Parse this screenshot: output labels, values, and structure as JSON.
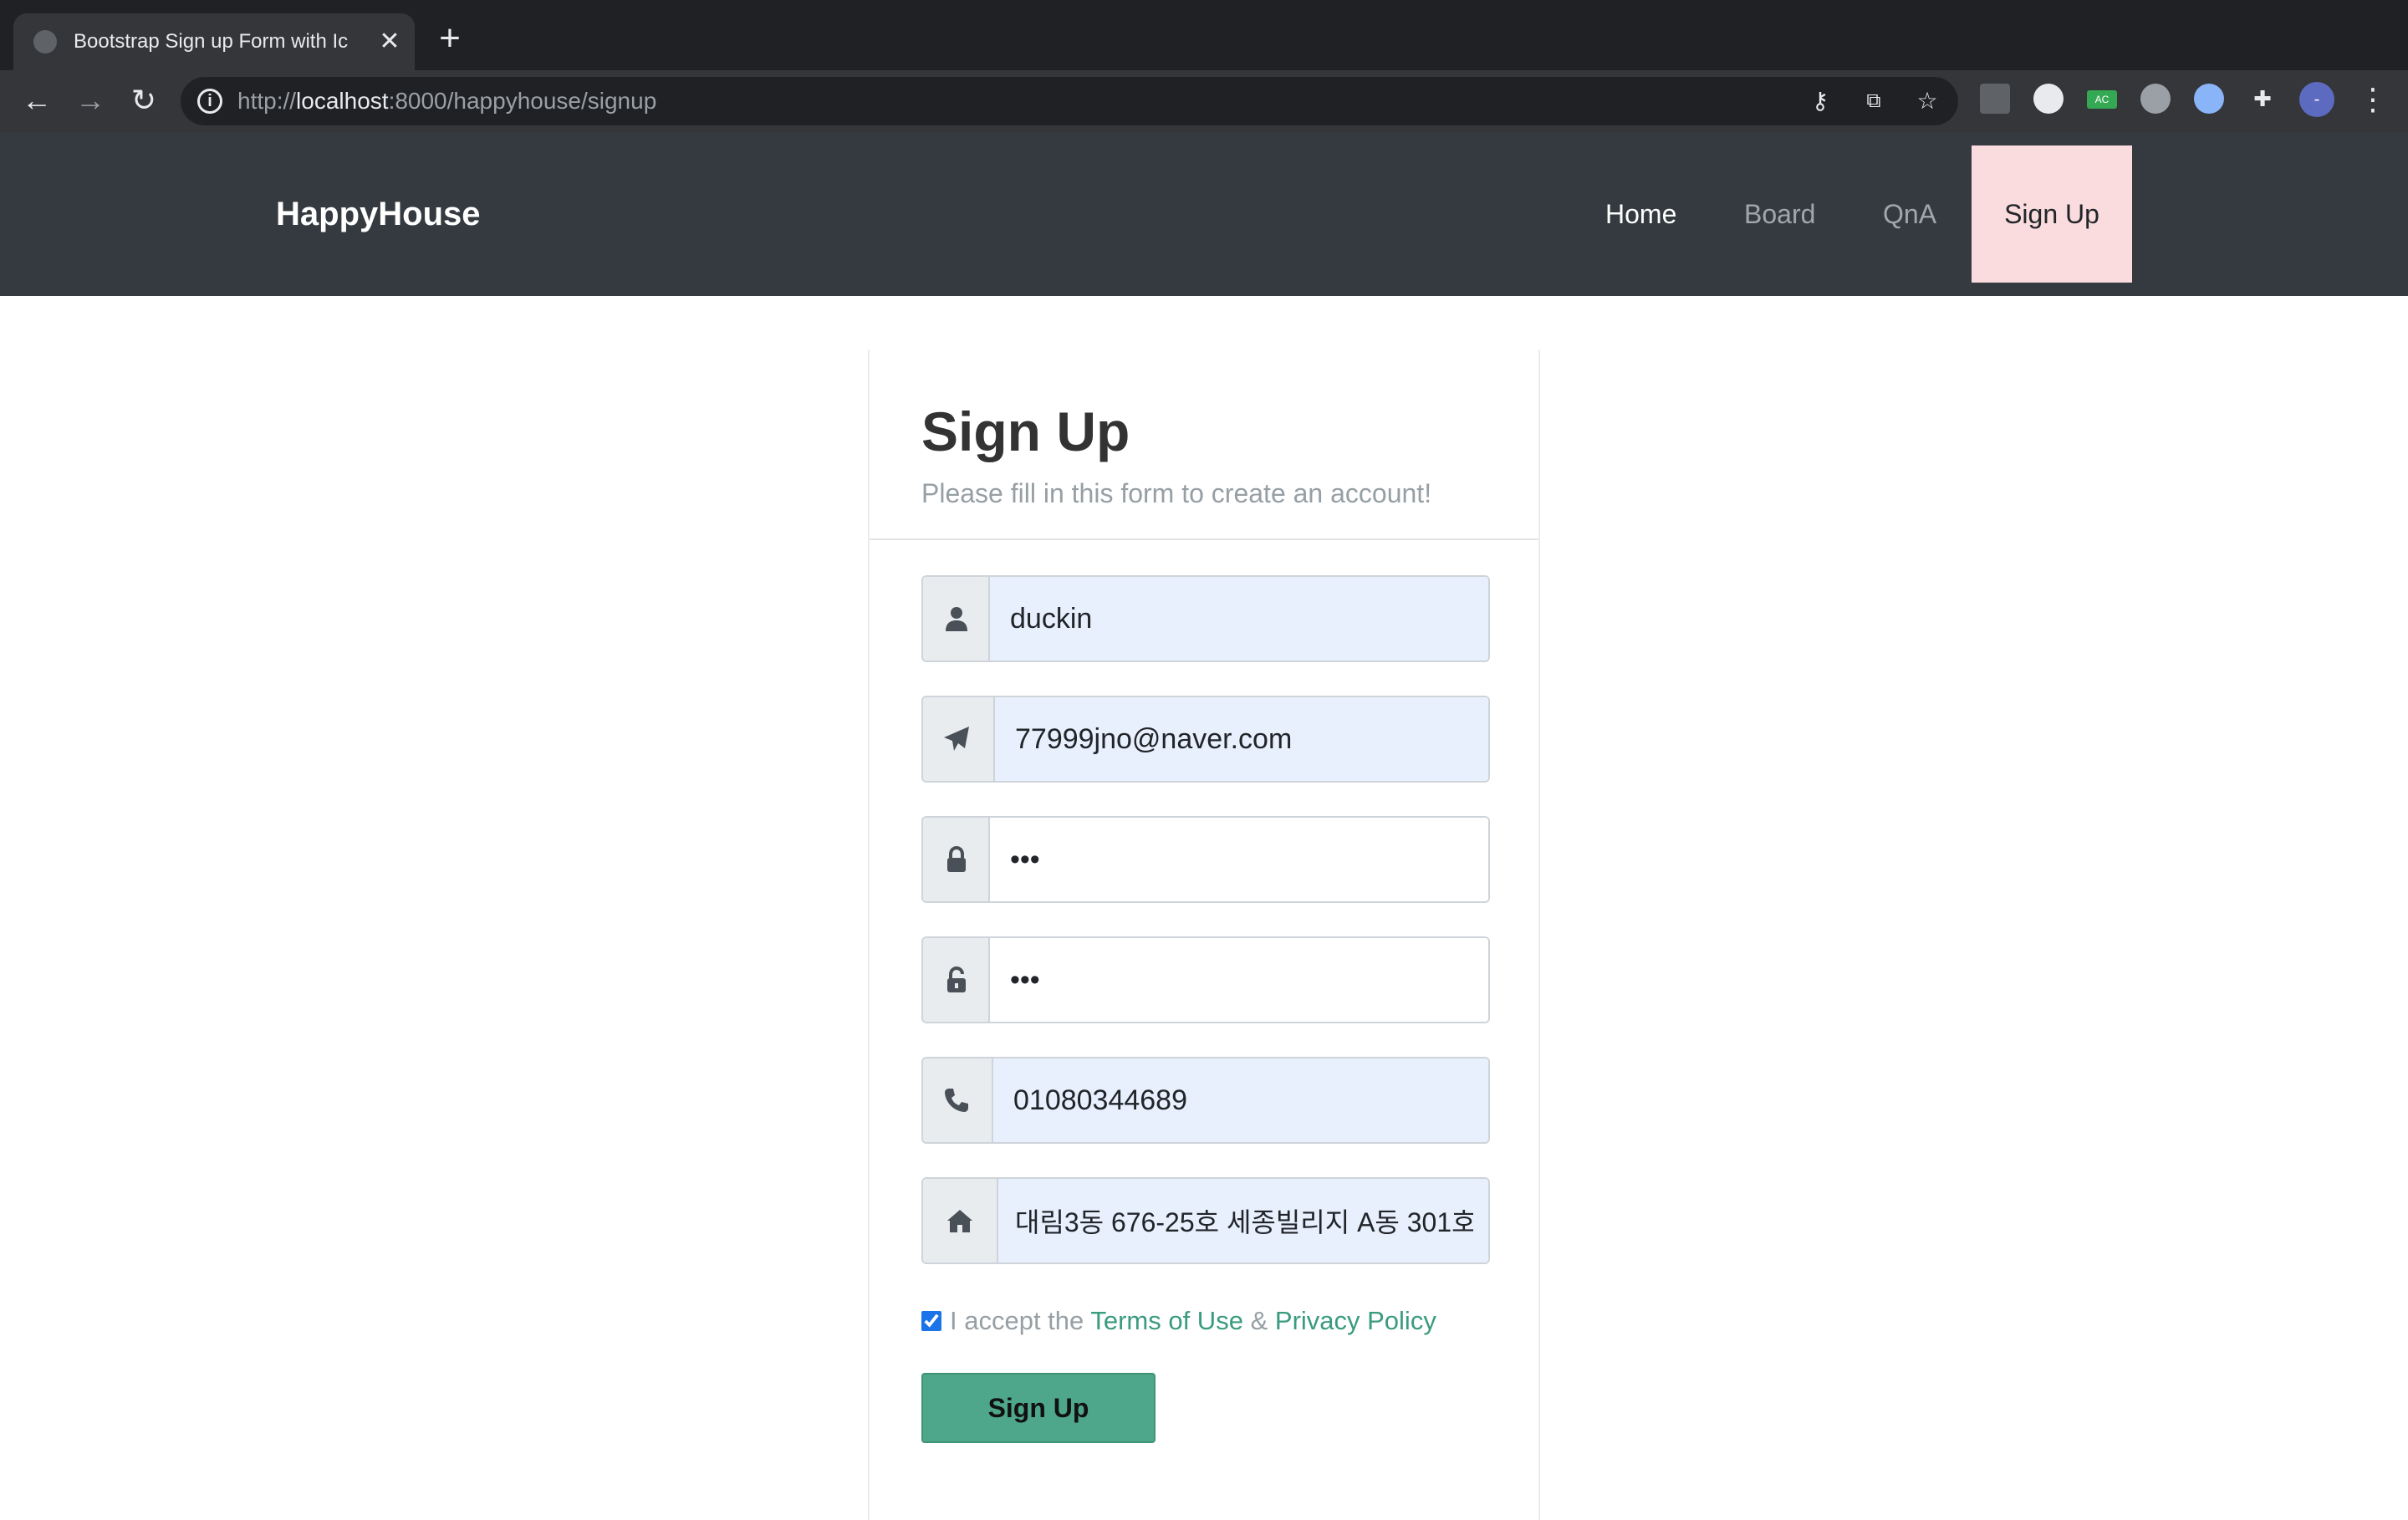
{
  "browser": {
    "tab_title": "Bootstrap Sign up Form with Ic",
    "tab_close": "✕",
    "new_tab": "+",
    "url_scheme": "http://",
    "url_host": "localhost",
    "url_path": ":8000/happyhouse/signup",
    "avatar_letter": "-",
    "icons": [
      "back-icon",
      "forward-icon",
      "reload-icon",
      "info-icon",
      "key-icon",
      "translate-icon",
      "star-icon",
      "extensions-icon",
      "menu-icon"
    ]
  },
  "navbar": {
    "brand": "HappyHouse",
    "links": [
      "Home",
      "Board",
      "QnA",
      "Sign Up"
    ],
    "active_highlight_color": "#fadcde"
  },
  "form": {
    "title": "Sign Up",
    "hint": "Please fill in this form to create an account!",
    "username_value": "duckin",
    "email_value": "77999jno@naver.com",
    "password_value": "•••",
    "confirm_password_value": "•••",
    "phone_value": "01080344689",
    "address_value": "대림3동 676-25호 세종빌리지 A동 301호",
    "terms_prefix": "I accept the",
    "terms_link": "Terms of Use",
    "terms_and": "&",
    "privacy_link": "Privacy Policy",
    "terms_checked": true,
    "submit_label": "Sign Up",
    "accent_color": "#4ea78a",
    "autofill_color": "#e8f0fe"
  }
}
